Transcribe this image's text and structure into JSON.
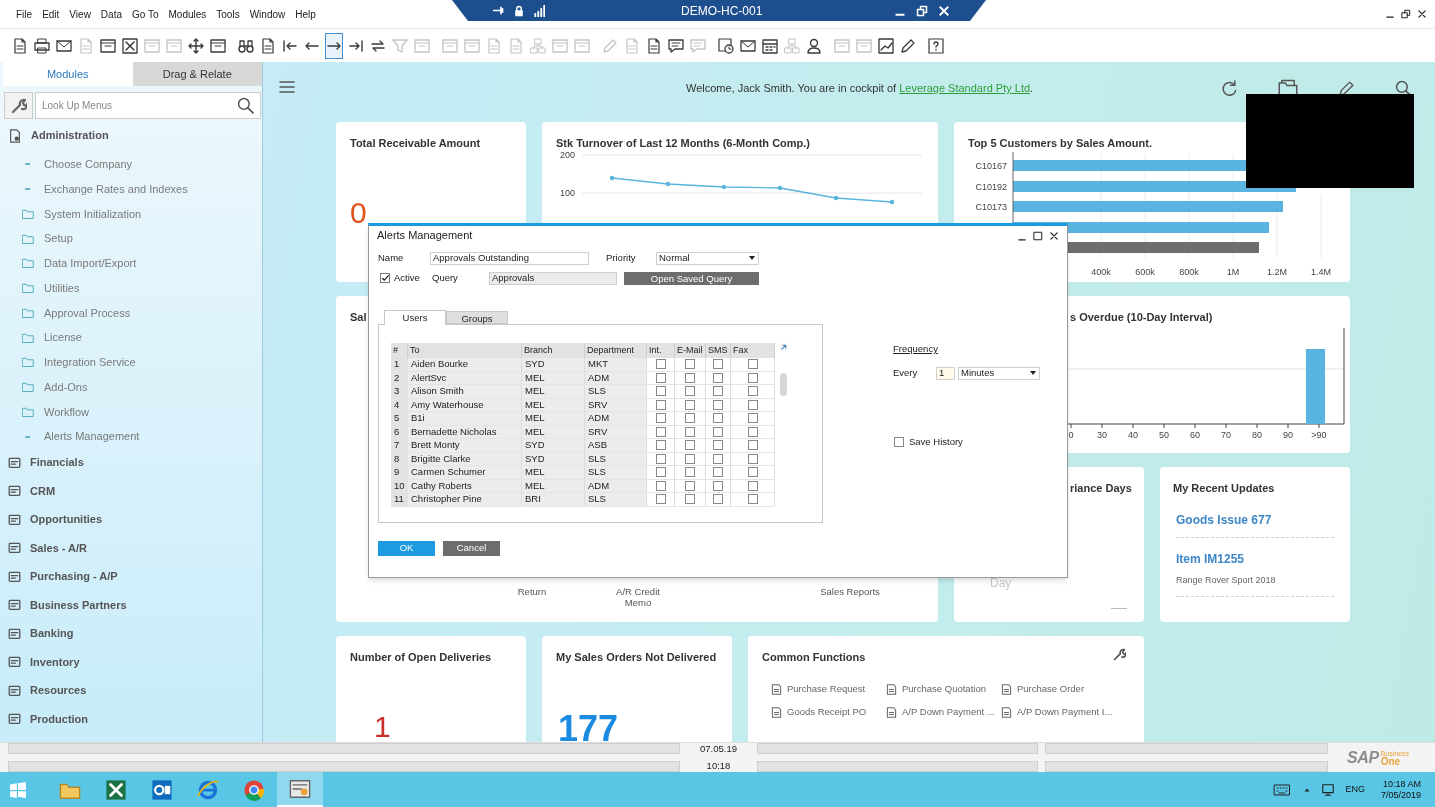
{
  "window": {
    "title": "DEMO-HC-001"
  },
  "menu_bar": [
    "File",
    "Edit",
    "View",
    "Data",
    "Go To",
    "Modules",
    "Tools",
    "Window",
    "Help"
  ],
  "toolbar": {
    "groups": [
      [
        {
          "disabled": false,
          "selected": false
        },
        {
          "disabled": false,
          "selected": false
        },
        {
          "disabled": false,
          "selected": false
        },
        {
          "disabled": true,
          "selected": false
        },
        {
          "disabled": false,
          "selected": false
        },
        {
          "disabled": false,
          "selected": false
        },
        {
          "disabled": true,
          "selected": false
        },
        {
          "disabled": true,
          "selected": false
        },
        {
          "disabled": false,
          "selected": false
        },
        {
          "disabled": false,
          "selected": false
        }
      ],
      [
        {
          "disabled": false,
          "selected": false
        },
        {
          "disabled": false,
          "selected": false
        },
        {
          "disabled": false,
          "selected": false
        },
        {
          "disabled": false,
          "selected": false
        },
        {
          "disabled": false,
          "selected": true
        },
        {
          "disabled": false,
          "selected": false
        },
        {
          "disabled": false,
          "selected": false
        },
        {
          "disabled": true,
          "selected": false
        },
        {
          "disabled": true,
          "selected": false
        }
      ],
      [
        {
          "disabled": true,
          "selected": false
        },
        {
          "disabled": true,
          "selected": false
        },
        {
          "disabled": true,
          "selected": false
        },
        {
          "disabled": true,
          "selected": false
        },
        {
          "disabled": true,
          "selected": false
        },
        {
          "disabled": true,
          "selected": false
        },
        {
          "disabled": true,
          "selected": false
        }
      ],
      [
        {
          "disabled": true,
          "selected": false
        },
        {
          "disabled": true,
          "selected": false
        },
        {
          "disabled": false,
          "selected": false
        },
        {
          "disabled": false,
          "selected": false
        },
        {
          "disabled": true,
          "selected": false
        }
      ],
      [
        {
          "disabled": false,
          "selected": false
        },
        {
          "disabled": false,
          "selected": false
        },
        {
          "disabled": false,
          "selected": false
        },
        {
          "disabled": true,
          "selected": false
        },
        {
          "disabled": false,
          "selected": false
        }
      ],
      [
        {
          "disabled": true,
          "selected": false
        },
        {
          "disabled": true,
          "selected": false
        },
        {
          "disabled": false,
          "selected": false
        },
        {
          "disabled": false,
          "selected": false
        }
      ],
      [
        {
          "disabled": false,
          "selected": false
        }
      ]
    ]
  },
  "sidebar": {
    "tabs": [
      {
        "label": "Modules",
        "selected": true
      },
      {
        "label": "Drag & Relate",
        "selected": false
      }
    ],
    "search": {
      "placeholder": "Look Up Menus"
    },
    "modules": [
      {
        "label": "Administration",
        "children": [
          {
            "label": "Choose Company",
            "kind": "item"
          },
          {
            "label": "Exchange Rates and Indexes",
            "kind": "item"
          },
          {
            "label": "System Initialization",
            "kind": "folder"
          },
          {
            "label": "Setup",
            "kind": "folder"
          },
          {
            "label": "Data Import/Export",
            "kind": "folder"
          },
          {
            "label": "Utilities",
            "kind": "folder"
          },
          {
            "label": "Approval Process",
            "kind": "folder"
          },
          {
            "label": "License",
            "kind": "folder"
          },
          {
            "label": "Integration Service",
            "kind": "folder"
          },
          {
            "label": "Add-Ons",
            "kind": "folder"
          },
          {
            "label": "Workflow",
            "kind": "folder"
          },
          {
            "label": "Alerts Management",
            "kind": "item"
          }
        ]
      },
      {
        "label": "Financials"
      },
      {
        "label": "CRM"
      },
      {
        "label": "Opportunities"
      },
      {
        "label": "Sales - A/R"
      },
      {
        "label": "Purchasing - A/P"
      },
      {
        "label": "Business Partners"
      },
      {
        "label": "Banking"
      },
      {
        "label": "Inventory"
      },
      {
        "label": "Resources"
      },
      {
        "label": "Production"
      }
    ]
  },
  "cockpit": {
    "welcome": "Welcome, Jack Smith. You are in cockpit of ",
    "company_link": "Leverage Standard Pty Ltd",
    "welcome_end": ".",
    "total_receivable": {
      "title": "Total Receivable Amount",
      "value": "0"
    },
    "stock_turnover": {
      "title": "Stk Turnover of Last 12 Months (6-Month Comp.)",
      "y_labels": [
        "200",
        "100"
      ]
    },
    "top_customers": {
      "title": "Top 5 Customers by Sales Amount.",
      "y_labels": [
        "C10167",
        "C10192",
        "C10173"
      ],
      "x_labels": [
        "400k",
        "600k",
        "800k",
        "1M",
        "1.2M",
        "1.4M"
      ]
    },
    "sales_card": {
      "title": "Sal",
      "shortcuts": [
        "Return",
        "A/R Credit\nMemo",
        "Sales Reports"
      ]
    },
    "overdue_card": {
      "title": "s Overdue (10-Day Interval)",
      "x_labels": [
        "0",
        "30",
        "40",
        "50",
        "60",
        "70",
        "80",
        "90",
        ">90"
      ]
    },
    "variance_card": {
      "title": "riance Days",
      "label": "Day"
    },
    "recent_updates": {
      "title": "My Recent Updates",
      "items": [
        {
          "title": "Goods Issue 677"
        },
        {
          "title": "Item IM1255",
          "subtitle": "Range Rover Sport 2018"
        }
      ]
    },
    "open_deliveries": {
      "title": "Number of Open Deliveries",
      "value": "1"
    },
    "sales_orders": {
      "title": "My Sales Orders Not Delivered",
      "value": "177"
    },
    "common_functions": {
      "title": "Common Functions",
      "items": [
        "Purchase Request",
        "Purchase Quotation",
        "Purchase Order",
        "Goods Receipt PO",
        "A/P Down Payment ...",
        "A/P Down Payment I..."
      ]
    }
  },
  "dialog": {
    "title": "Alerts Management",
    "name_label": "Name",
    "name_value": "Approvals Outstanding",
    "priority_label": "Priority",
    "priority_value": "Normal",
    "active": {
      "label": "Active",
      "checked": true
    },
    "query_label": "Query",
    "query_value": "Approvals",
    "open_query_button": "Open Saved Query",
    "tabs": [
      {
        "label": "Users",
        "selected": true
      },
      {
        "label": "Groups",
        "selected": false
      }
    ],
    "columns": [
      "#",
      "To",
      "Branch",
      "Department",
      "Int.",
      "E-Mail",
      "SMS",
      "Fax"
    ],
    "rows": [
      {
        "no": "1",
        "to": "Aiden Bourke",
        "branch": "SYD",
        "department": "MKT",
        "int": false,
        "email": false,
        "sms": false,
        "fax": false
      },
      {
        "no": "2",
        "to": "AlertSvc",
        "branch": "MEL",
        "department": "ADM",
        "int": false,
        "email": false,
        "sms": false,
        "fax": false
      },
      {
        "no": "3",
        "to": "Alison Smith",
        "branch": "MEL",
        "department": "SLS",
        "int": false,
        "email": false,
        "sms": false,
        "fax": false
      },
      {
        "no": "4",
        "to": "Amy Waterhouse",
        "branch": "MEL",
        "department": "SRV",
        "int": false,
        "email": false,
        "sms": false,
        "fax": false
      },
      {
        "no": "5",
        "to": "B1i",
        "branch": "MEL",
        "department": "ADM",
        "int": false,
        "email": false,
        "sms": false,
        "fax": false
      },
      {
        "no": "6",
        "to": "Bernadette Nicholas",
        "branch": "MEL",
        "department": "SRV",
        "int": false,
        "email": false,
        "sms": false,
        "fax": false
      },
      {
        "no": "7",
        "to": "Brett Monty",
        "branch": "SYD",
        "department": "ASB",
        "int": false,
        "email": false,
        "sms": false,
        "fax": false
      },
      {
        "no": "8",
        "to": "Brigitte Clarke",
        "branch": "SYD",
        "department": "SLS",
        "int": false,
        "email": false,
        "sms": false,
        "fax": false
      },
      {
        "no": "9",
        "to": "Carmen Schumer",
        "branch": "MEL",
        "department": "SLS",
        "int": false,
        "email": false,
        "sms": false,
        "fax": false
      },
      {
        "no": "10",
        "to": "Cathy Roberts",
        "branch": "MEL",
        "department": "ADM",
        "int": false,
        "email": false,
        "sms": false,
        "fax": false
      },
      {
        "no": "11",
        "to": "Christopher Pine",
        "branch": "BRI",
        "department": "SLS",
        "int": false,
        "email": false,
        "sms": false,
        "fax": false
      }
    ],
    "frequency_label": "Frequency",
    "every_label": "Every",
    "every_value": "1",
    "unit_value": "Minutes",
    "save_history": {
      "label": "Save History",
      "checked": false
    },
    "buttons": [
      "OK",
      "Cancel"
    ]
  },
  "status_bar": {
    "date": "07.05.19",
    "time": "10:18",
    "logo": {
      "brand": "SAP",
      "line1": "Business",
      "line2": "One"
    }
  },
  "taskbar": {
    "apps": [
      {
        "kind": "files",
        "selected": false
      },
      {
        "kind": "spreadsheet",
        "selected": false
      },
      {
        "kind": "mail",
        "selected": false
      },
      {
        "kind": "browser",
        "selected": false
      },
      {
        "kind": "chrome",
        "selected": false
      },
      {
        "kind": "erp",
        "selected": true
      }
    ],
    "language": "ENG",
    "time": "10:18 AM",
    "date": "7/05/2019"
  }
}
